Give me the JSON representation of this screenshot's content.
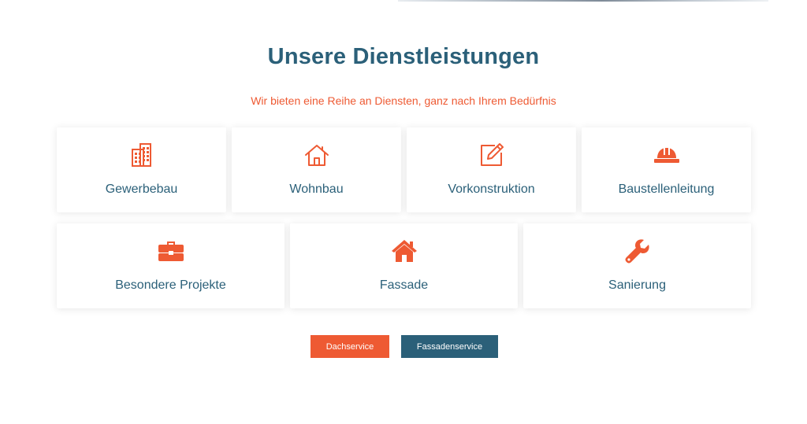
{
  "section": {
    "title": "Unsere Dienstleistungen",
    "subtitle": "Wir bieten eine Reihe an Diensten, ganz nach Ihrem Bedürfnis"
  },
  "services_row1": [
    {
      "label": "Gewerbebau",
      "icon": "office-building-icon"
    },
    {
      "label": "Wohnbau",
      "icon": "house-outline-icon"
    },
    {
      "label": "Vorkonstruktion",
      "icon": "edit-pencil-square-icon"
    },
    {
      "label": "Baustellenleitung",
      "icon": "hard-hat-icon"
    }
  ],
  "services_row2": [
    {
      "label": "Besondere Projekte",
      "icon": "toolbox-icon"
    },
    {
      "label": "Fassade",
      "icon": "house-solid-icon"
    },
    {
      "label": "Sanierung",
      "icon": "wrench-icon"
    }
  ],
  "buttons": {
    "primary": "Dachservice",
    "secondary": "Fassadenservice"
  },
  "colors": {
    "accent": "#ee5a33",
    "brand": "#2b6079"
  }
}
